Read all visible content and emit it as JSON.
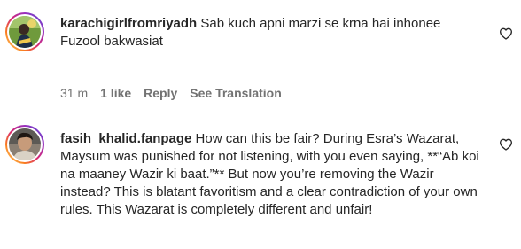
{
  "comments": [
    {
      "username": "karachigirlfromriyadh",
      "text": "Sab kuch apni marzi se krna hai inhonee\nFuzool bakwasiat",
      "time": "31 m",
      "likes": "1 like",
      "reply_label": "Reply",
      "translation_label": "See Translation",
      "like_icon": "heart-outline-icon",
      "avatar": "profile-avatar"
    },
    {
      "username": "fasih_khalid.fanpage",
      "text": "How can this be fair? During Esra’s Wazarat, Maysum was punished for not listening, with you even saying, **“Ab koi na maaney Wazir ki baat.”** But now you’re removing the Wazir instead? This is blatant favoritism and a clear contradiction of your own rules. This Wazarat is completely different and unfair!",
      "like_icon": "heart-outline-icon",
      "avatar": "profile-avatar"
    }
  ],
  "colors": {
    "text": "#262626",
    "secondary": "#737373",
    "ring_gradient": [
      "#feda75",
      "#fa7e1e",
      "#d62976",
      "#962fbf",
      "#4f5bd5"
    ]
  }
}
